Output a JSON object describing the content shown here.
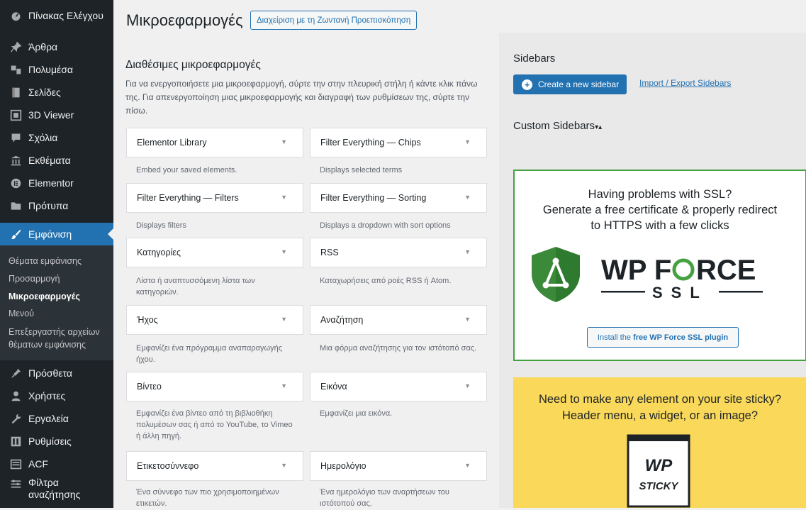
{
  "menu": [
    {
      "label": "Πίνακας Ελέγχου",
      "icon": "dashboard-icon"
    },
    {
      "label": "Άρθρα",
      "icon": "pin-icon"
    },
    {
      "label": "Πολυμέσα",
      "icon": "media-icon"
    },
    {
      "label": "Σελίδες",
      "icon": "page-icon"
    },
    {
      "label": "3D Viewer",
      "icon": "3d-viewer-icon"
    },
    {
      "label": "Σχόλια",
      "icon": "comment-icon"
    },
    {
      "label": "Εκθέματα",
      "icon": "museum-icon"
    },
    {
      "label": "Elementor",
      "icon": "elementor-icon"
    },
    {
      "label": "Πρότυπα",
      "icon": "folder-icon"
    },
    {
      "label": "Εμφάνιση",
      "icon": "appearance-icon"
    },
    {
      "label": "Πρόσθετα",
      "icon": "plugin-icon"
    },
    {
      "label": "Χρήστες",
      "icon": "user-icon"
    },
    {
      "label": "Εργαλεία",
      "icon": "tools-icon"
    },
    {
      "label": "Ρυθμίσεις",
      "icon": "settings-icon"
    },
    {
      "label": "ACF",
      "icon": "acf-icon"
    },
    {
      "label": "Φίλτρα αναζήτησης",
      "icon": "filter-icon"
    }
  ],
  "submenu": [
    "Θέματα εμφάνισης",
    "Προσαρμογή",
    "Μικροεφαρμογές",
    "Μενού",
    "Επεξεργαστής αρχείων θέματων εμφάνισης"
  ],
  "page": {
    "title": "Μικροεφαρμογές",
    "live_button": "Διαχείριση με τη Ζωντανή Προεπισκόπηση",
    "available_title": "Διαθέσιμες μικροεφαρμογές",
    "available_desc": "Για να ενεργοποιήσετε μια μικροεφαρμογή, σύρτε την στην πλευρική στήλη ή κάντε κλικ πάνω της. Για απενεργοποίηση μιας μικροεφαρμογής και διαγραφή των ρυθμίσεων της, σύρτε την πίσω."
  },
  "widgets": [
    {
      "title": "Elementor Library",
      "desc": "Embed your saved elements."
    },
    {
      "title": "Filter Everything — Chips",
      "desc": "Displays selected terms"
    },
    {
      "title": "Filter Everything — Filters",
      "desc": "Displays filters"
    },
    {
      "title": "Filter Everything — Sorting",
      "desc": "Displays a dropdown with sort options"
    },
    {
      "title": "Κατηγορίες",
      "desc": "Λίστα ή αναπτυσσόμενη λίστα των κατηγοριών."
    },
    {
      "title": "RSS",
      "desc": "Καταχωρήσεις από ροές RSS ή Atom."
    },
    {
      "title": "Ήχος",
      "desc": "Εμφανίζει ένα πρόγραμμα αναπαραγωγής ήχου."
    },
    {
      "title": "Αναζήτηση",
      "desc": "Μια φόρμα αναζήτησης για τον ιστότοπό σας."
    },
    {
      "title": "Βίντεο",
      "desc": "Εμφανίζει ένα βίντεο από τη βιβλιοθήκη πολυμέσων σας ή από το YouTube, το Vimeo ή άλλη πηγή."
    },
    {
      "title": "Εικόνα",
      "desc": "Εμφανίζει μια εικόνα."
    },
    {
      "title": "Ετικετοσύννεφο",
      "desc": "Ένα σύννεφο των πιο χρησιμοποιημένων ετικετών."
    },
    {
      "title": "Ημερολόγιο",
      "desc": "Ένα ημερολόγιο των αναρτήσεων του ιστότοπού σας."
    }
  ],
  "sidebars": {
    "title": "Sidebars",
    "create_button": "Create a new sidebar",
    "import_link": "Import / Export Sidebars",
    "custom_title": "Custom Sidebars",
    "custom_toggle": "▾▴"
  },
  "ssl_ad": {
    "line1": "Having problems with SSL?",
    "line2": "Generate a free certificate & properly redirect",
    "line3": "to HTTPS with a few clicks",
    "logo_text": "WP FORCE SSL",
    "button_prefix": "Install the",
    "button_bold": "free WP Force SSL plugin"
  },
  "sticky_ad": {
    "line1": "Need to make any element on your site sticky?",
    "line2": "Header menu, a widget, or an image?",
    "logo_text": "WP STICKY"
  },
  "colors": {
    "accent": "#2271b1",
    "admin_menu": "#1d2327",
    "ssl_green": "#46a142",
    "sticky_yellow": "#f9d85a"
  }
}
